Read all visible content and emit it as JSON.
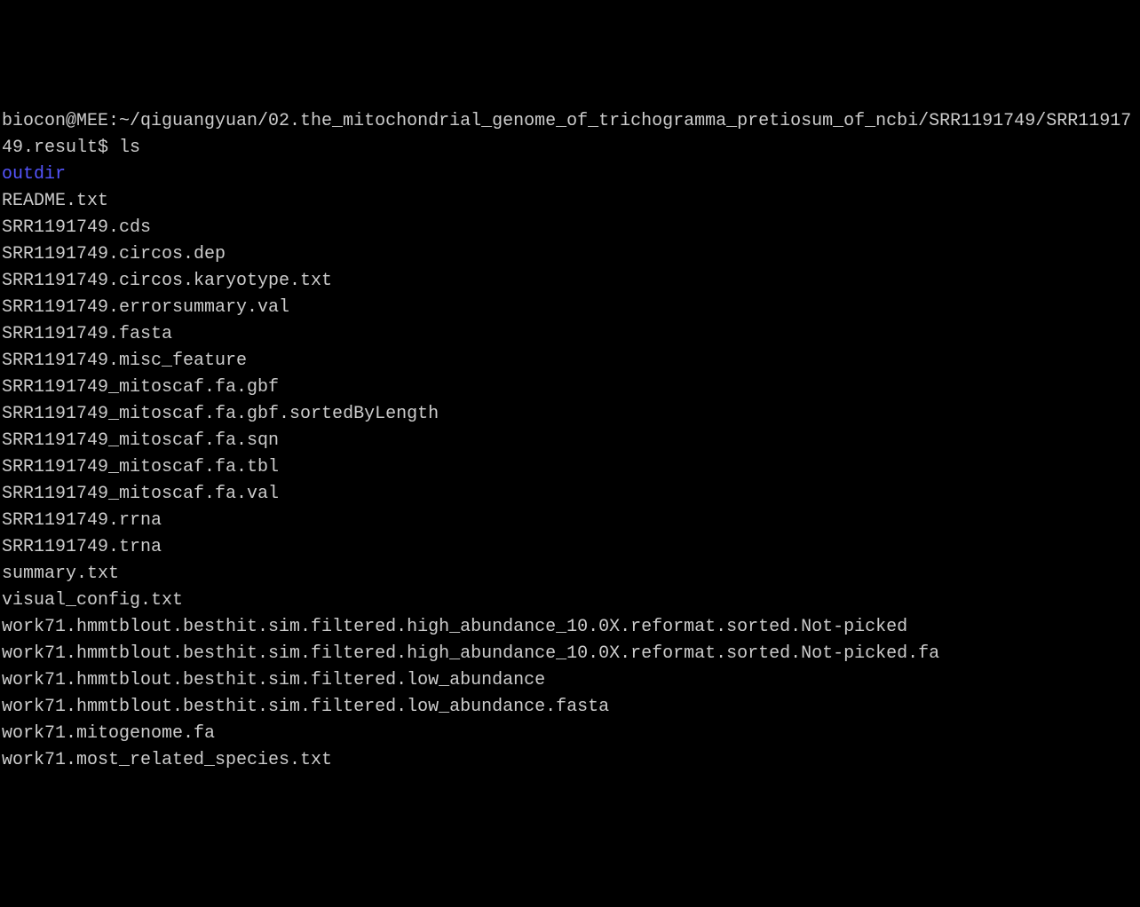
{
  "terminal": {
    "prompt": "biocon@MEE:~/qiguangyuan/02.the_mitochondrial_genome_of_trichogramma_pretiosum_of_ncbi/SRR1191749/SRR1191749.result$ ",
    "command": "ls",
    "output": {
      "directories": [
        "outdir"
      ],
      "files": [
        "README.txt",
        "SRR1191749.cds",
        "SRR1191749.circos.dep",
        "SRR1191749.circos.karyotype.txt",
        "SRR1191749.errorsummary.val",
        "SRR1191749.fasta",
        "SRR1191749.misc_feature",
        "SRR1191749_mitoscaf.fa.gbf",
        "SRR1191749_mitoscaf.fa.gbf.sortedByLength",
        "SRR1191749_mitoscaf.fa.sqn",
        "SRR1191749_mitoscaf.fa.tbl",
        "SRR1191749_mitoscaf.fa.val",
        "SRR1191749.rrna",
        "SRR1191749.trna",
        "summary.txt",
        "visual_config.txt",
        "work71.hmmtblout.besthit.sim.filtered.high_abundance_10.0X.reformat.sorted.Not-picked",
        "work71.hmmtblout.besthit.sim.filtered.high_abundance_10.0X.reformat.sorted.Not-picked.fa",
        "work71.hmmtblout.besthit.sim.filtered.low_abundance",
        "work71.hmmtblout.besthit.sim.filtered.low_abundance.fasta",
        "work71.mitogenome.fa",
        "work71.most_related_species.txt"
      ]
    }
  }
}
